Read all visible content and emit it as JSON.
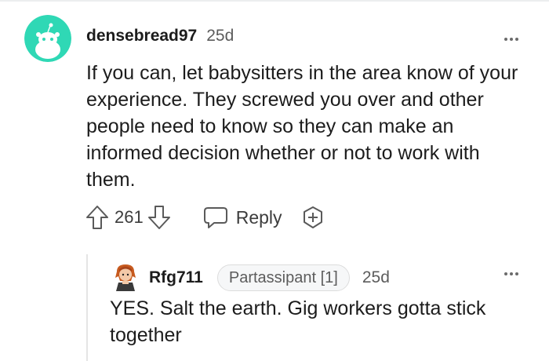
{
  "comment": {
    "username": "densebread97",
    "time": "25d",
    "body": "If you can, let babysitters in the area know of your experience. They screwed you over and other people need to know so they can make an informed decision whether or not to work with them.",
    "score": "261",
    "reply_label": "Reply",
    "avatar_color": "#2fd8b5"
  },
  "reply": {
    "username": "Rfg711",
    "flair": "Partassipant [1]",
    "time": "25d",
    "body": "YES. Salt the earth. Gig workers gotta stick together"
  },
  "icons": {
    "upvote": "upvote-arrow-icon",
    "downvote": "downvote-arrow-icon",
    "reply": "speech-bubble-icon",
    "award": "award-plus-icon",
    "more": "more-options-icon"
  }
}
